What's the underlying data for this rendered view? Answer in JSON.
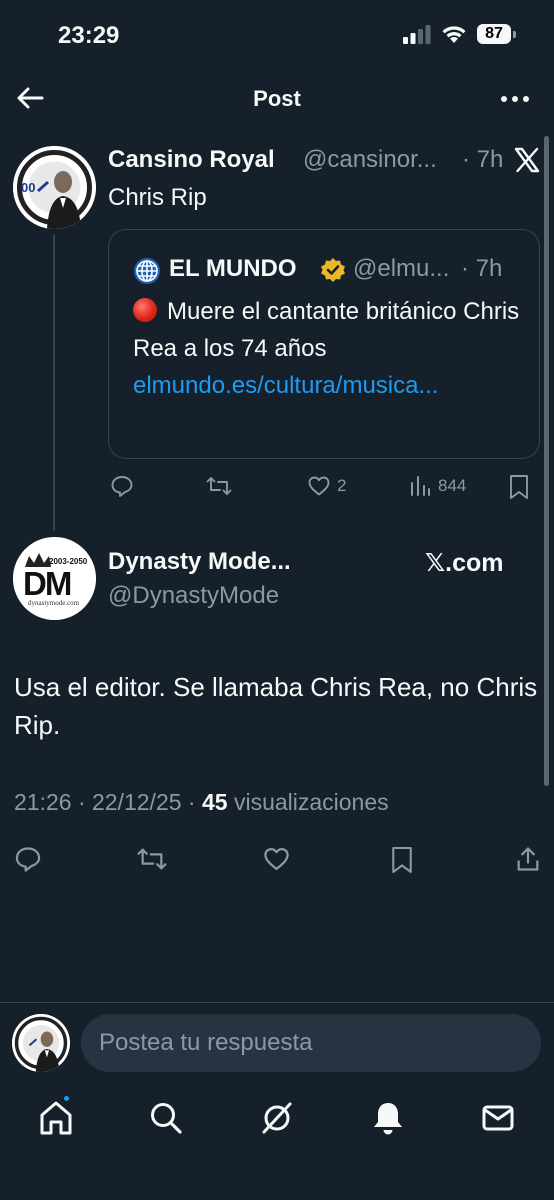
{
  "status_bar": {
    "time": "23:29",
    "battery": "87",
    "icons": [
      "signal-icon",
      "wifi-icon",
      "battery-icon"
    ]
  },
  "nav": {
    "title": "Post",
    "back_icon": "arrow-left-icon",
    "more_icon": "more-dots-icon"
  },
  "post1": {
    "name": "Cansino Royal",
    "handle": "@cansinor...",
    "time": "· 7h",
    "text": "Chris Rip",
    "quote": {
      "name": "EL MUNDO",
      "handle": "@elmu...",
      "time": "· 7h",
      "text": "Muere el cantante británico Chris Rea a los 74 años",
      "link": "elmundo.es/cultura/musica..."
    },
    "actions": {
      "replies": "",
      "reposts": "",
      "likes": "2",
      "views": "844"
    }
  },
  "post2": {
    "name": "Dynasty Mode...",
    "source": "𝕏.com",
    "handle": "@DynastyMode",
    "text": "Usa el editor. Se llamaba Chris Rea, no Chris Rip.",
    "timestamp": "21:26 · 22/12/25 ·",
    "views_count": "45",
    "views_label": "visualizaciones",
    "avatar_text": "DM",
    "avatar_years": "2003-2050",
    "avatar_site": "dynastymode.com"
  },
  "reply": {
    "placeholder": "Postea tu respuesta"
  },
  "tabbar": {
    "tabs": [
      "home-icon",
      "search-icon",
      "grok-icon",
      "bell-icon",
      "mail-icon"
    ]
  },
  "colors": {
    "background": "#15202b",
    "accent": "#1d9bf0",
    "muted": "#8b98a5",
    "border": "#38444d",
    "verified_gold": "#e8b829"
  }
}
